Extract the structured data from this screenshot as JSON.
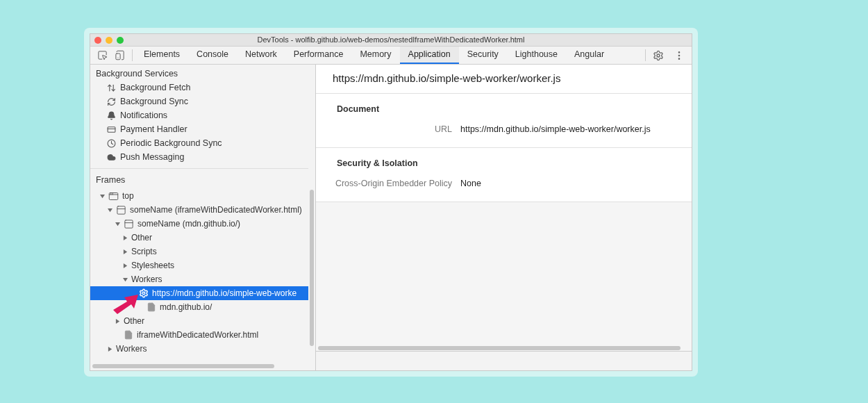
{
  "window": {
    "title": "DevTools - wolfib.github.io/web-demos/nestedIframeWithDedicatedWorker.html"
  },
  "tabs": [
    {
      "label": "Elements",
      "selected": false
    },
    {
      "label": "Console",
      "selected": false
    },
    {
      "label": "Network",
      "selected": false
    },
    {
      "label": "Performance",
      "selected": false
    },
    {
      "label": "Memory",
      "selected": false
    },
    {
      "label": "Application",
      "selected": true
    },
    {
      "label": "Security",
      "selected": false
    },
    {
      "label": "Lighthouse",
      "selected": false
    },
    {
      "label": "Angular",
      "selected": false
    }
  ],
  "sidebar": {
    "background_services": {
      "title": "Background Services",
      "items": [
        {
          "label": "Background Fetch",
          "kind": "fetch"
        },
        {
          "label": "Background Sync",
          "kind": "sync"
        },
        {
          "label": "Notifications",
          "kind": "bell"
        },
        {
          "label": "Payment Handler",
          "kind": "card"
        },
        {
          "label": "Periodic Background Sync",
          "kind": "clock"
        },
        {
          "label": "Push Messaging",
          "kind": "cloud"
        }
      ]
    },
    "frames": {
      "title": "Frames",
      "tree": [
        {
          "label": "top",
          "kind": "frame",
          "expanded": true,
          "selected": false,
          "children": [
            {
              "label": "someName (iframeWithDedicatedWorker.html)",
              "kind": "subframe",
              "expanded": true,
              "selected": false,
              "children": [
                {
                  "label": "someName (mdn.github.io/)",
                  "kind": "subframe",
                  "expanded": true,
                  "selected": false,
                  "children": [
                    {
                      "label": "Other",
                      "expanded": false,
                      "selected": false
                    },
                    {
                      "label": "Scripts",
                      "expanded": false,
                      "selected": false
                    },
                    {
                      "label": "Stylesheets",
                      "expanded": false,
                      "selected": false
                    },
                    {
                      "label": "Workers",
                      "expanded": true,
                      "selected": false,
                      "children": [
                        {
                          "label": "https://mdn.github.io/simple-web-worke",
                          "kind": "worker",
                          "selected": true,
                          "children": [
                            {
                              "label": "mdn.github.io/",
                              "kind": "file",
                              "selected": false
                            }
                          ]
                        }
                      ]
                    }
                  ]
                },
                {
                  "label": "Other",
                  "expanded": false,
                  "selected": false
                },
                {
                  "label": "iframeWithDedicatedWorker.html",
                  "kind": "file",
                  "selected": false
                }
              ]
            },
            {
              "label": "Workers",
              "expanded": false,
              "selected": false
            }
          ]
        }
      ]
    }
  },
  "detail": {
    "title": "https://mdn.github.io/simple-web-worker/worker.js",
    "sections": [
      {
        "title": "Document",
        "rows": [
          {
            "key": "URL",
            "value": "https://mdn.github.io/simple-web-worker/worker.js"
          }
        ]
      },
      {
        "title": "Security & Isolation",
        "rows": [
          {
            "key": "Cross-Origin Embedder Policy",
            "value": "None"
          }
        ]
      }
    ]
  }
}
